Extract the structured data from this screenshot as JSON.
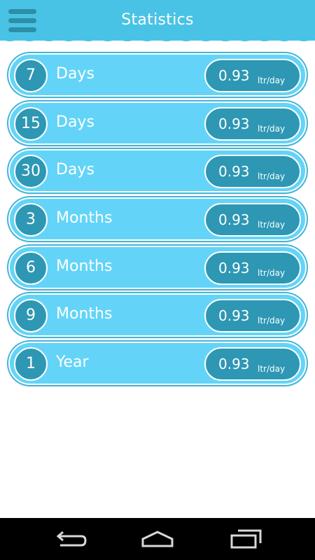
{
  "header": {
    "title": "Statistics",
    "menu_icon": "hamburger-menu-icon"
  },
  "stats": [
    {
      "number": "7",
      "period": "Days",
      "value": "0.93",
      "unit": "ltr/day"
    },
    {
      "number": "15",
      "period": "Days",
      "value": "0.93",
      "unit": "ltr/day"
    },
    {
      "number": "30",
      "period": "Days",
      "value": "0.93",
      "unit": "ltr/day"
    },
    {
      "number": "3",
      "period": "Months",
      "value": "0.93",
      "unit": "ltr/day"
    },
    {
      "number": "6",
      "period": "Months",
      "value": "0.93",
      "unit": "ltr/day"
    },
    {
      "number": "9",
      "period": "Months",
      "value": "0.93",
      "unit": "ltr/day"
    },
    {
      "number": "1",
      "period": "Year",
      "value": "0.93",
      "unit": "ltr/day"
    }
  ],
  "navbar": {
    "back_icon": "back-icon",
    "home_icon": "home-icon",
    "recents_icon": "recent-apps-icon"
  },
  "colors": {
    "header_bg": "#49c3e5",
    "row_bg": "#63d4f8",
    "accent_dark": "#2d97b4"
  }
}
